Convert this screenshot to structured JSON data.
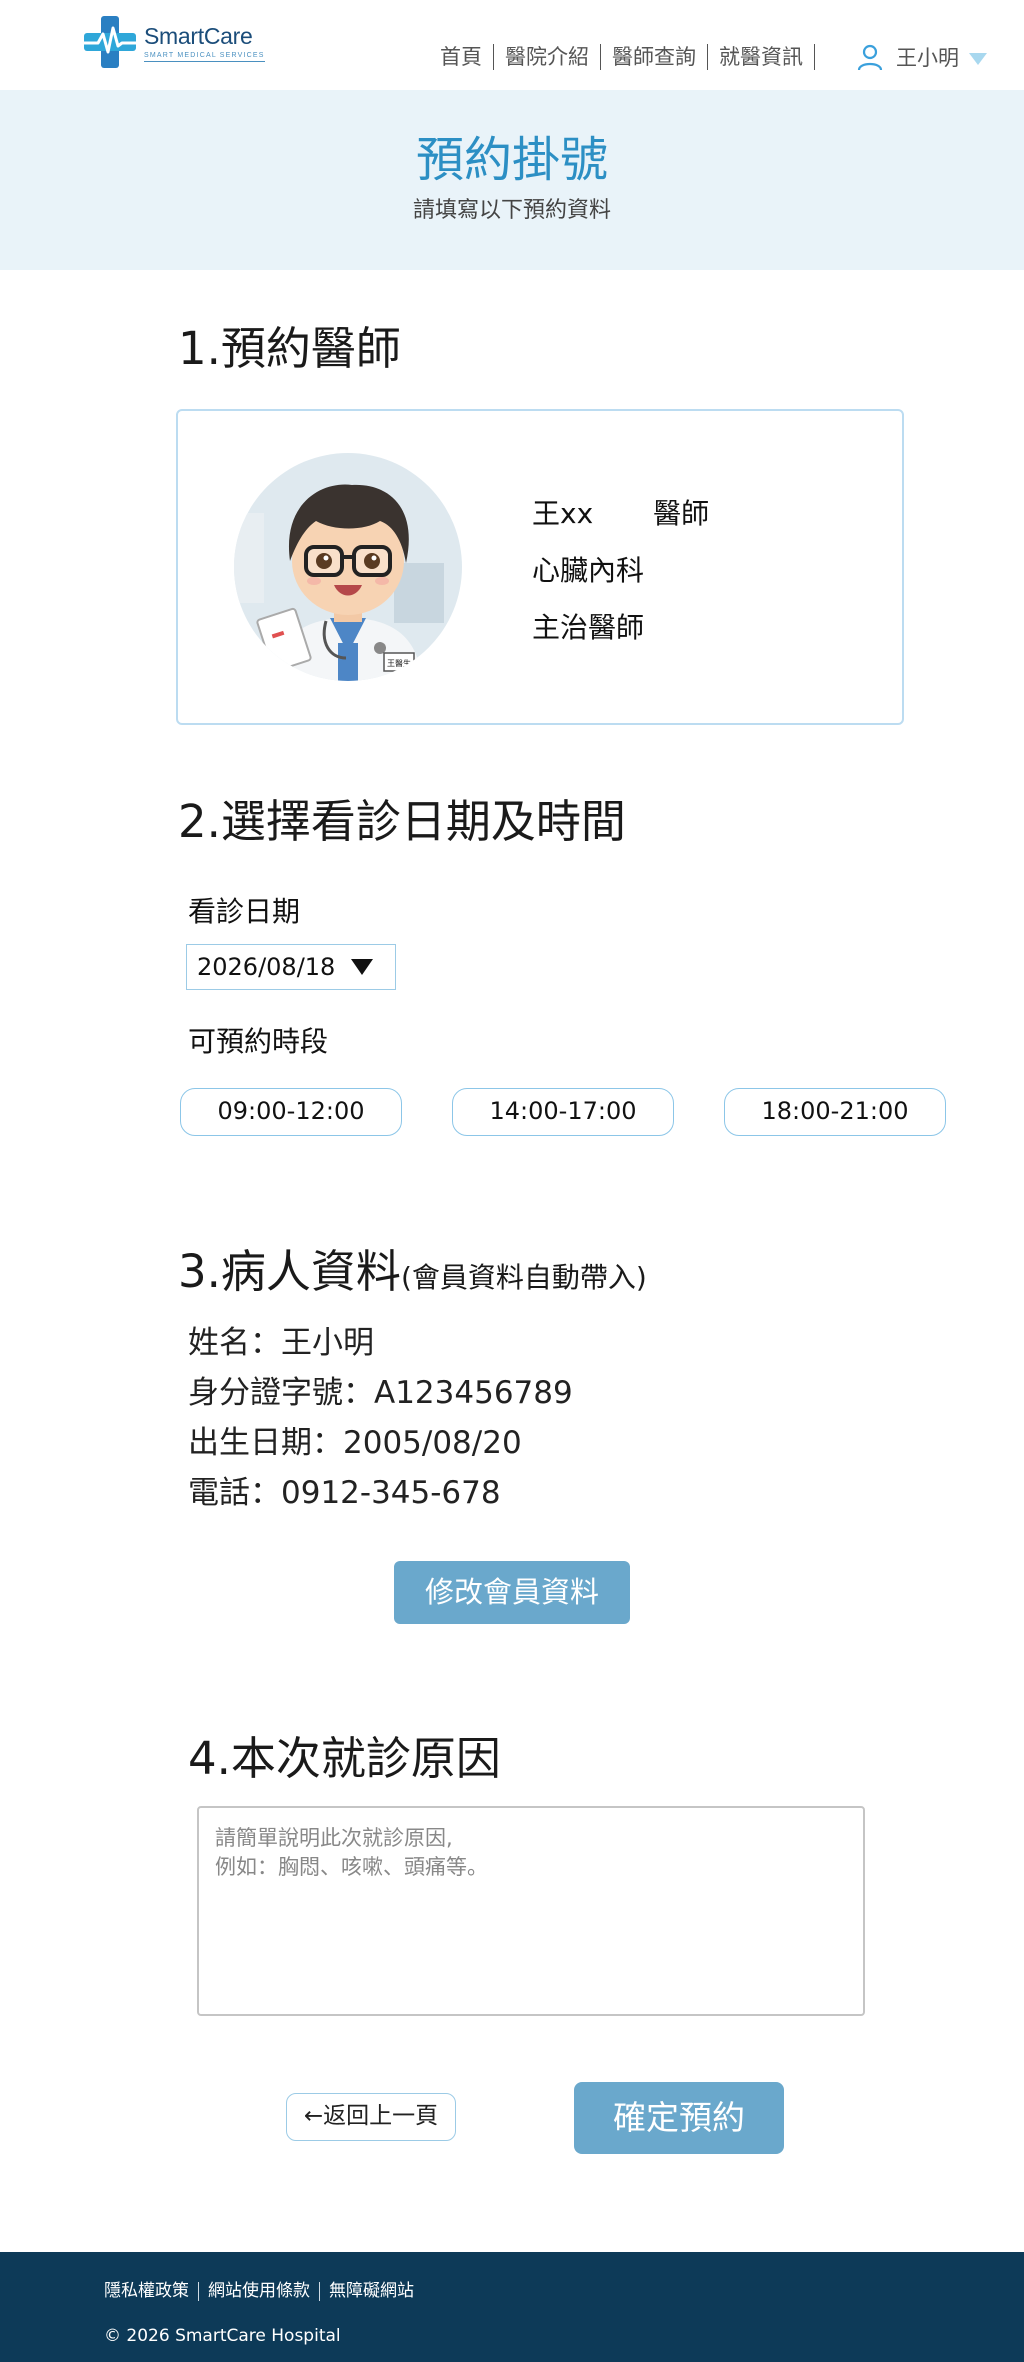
{
  "header": {
    "logo_name": "SmartCare",
    "logo_tagline": "SMART MEDICAL SERVICES",
    "nav": [
      "首頁",
      "醫院介紹",
      "醫師查詢",
      "就醫資訊"
    ],
    "user_name": "王小明"
  },
  "banner": {
    "title": "預約掛號",
    "subtitle": "請填寫以下預約資料"
  },
  "section1": {
    "title": "1.預約醫師",
    "doctor": {
      "name": "王xx",
      "title": "醫師",
      "department": "心臟內科",
      "position": "主治醫師",
      "badge": "王醫生"
    }
  },
  "section2": {
    "title": "2.選擇看診日期及時間",
    "date_label": "看診日期",
    "date_value": "2026/08/18",
    "slots_label": "可預約時段",
    "slots": [
      "09:00-12:00",
      "14:00-17:00",
      "18:00-21:00"
    ]
  },
  "section3": {
    "title": "3.病人資料",
    "note": "(會員資料自動帶入)",
    "fields": [
      "姓名：王小明",
      "身分證字號：A123456789",
      "出生日期：2005/08/20",
      "電話：0912-345-678"
    ],
    "edit_button": "修改會員資料"
  },
  "section4": {
    "title": "4.本次就診原因",
    "placeholder": "請簡單說明此次就診原因,\n例如：胸悶、咳嗽、頭痛等。"
  },
  "actions": {
    "back": "←返回上一頁",
    "confirm": "確定預約"
  },
  "footer": {
    "links": [
      "隱私權政策",
      "網站使用條款",
      "無障礙網站"
    ],
    "copyright": "© 2026 SmartCare Hospital"
  },
  "colors": {
    "accent": "#2c8fc4",
    "button": "#6aa8cc",
    "banner_bg": "#e9f3f9",
    "footer_bg": "#0d3a58"
  }
}
